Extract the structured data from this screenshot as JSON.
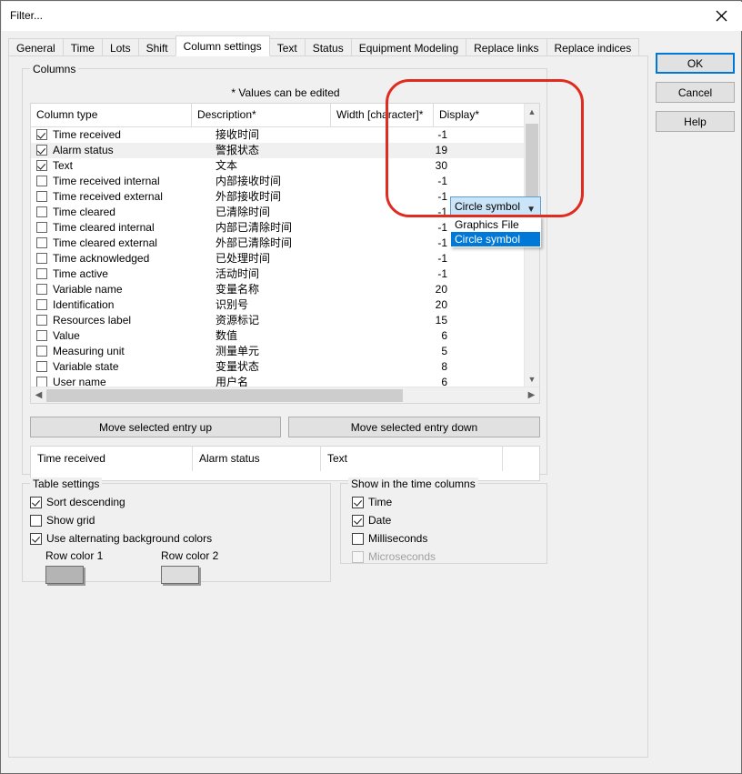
{
  "window": {
    "title": "Filter...",
    "close_icon": "close-icon"
  },
  "tabs": [
    {
      "label": "General",
      "selected": false
    },
    {
      "label": "Time",
      "selected": false
    },
    {
      "label": "Lots",
      "selected": false
    },
    {
      "label": "Shift",
      "selected": false
    },
    {
      "label": "Column settings",
      "selected": true
    },
    {
      "label": "Text",
      "selected": false
    },
    {
      "label": "Status",
      "selected": false
    },
    {
      "label": "Equipment Modeling",
      "selected": false
    },
    {
      "label": "Replace links",
      "selected": false
    },
    {
      "label": "Replace indices",
      "selected": false
    }
  ],
  "columns_group": {
    "title": "Columns",
    "note": "* Values can be edited",
    "headers": {
      "column_type": "Column type",
      "description": "Description*",
      "width": "Width [character]*",
      "display": "Display*"
    },
    "rows": [
      {
        "checked": true,
        "selected": false,
        "type": "Time received",
        "description": "接收时间",
        "width": "-1"
      },
      {
        "checked": true,
        "selected": true,
        "type": "Alarm status",
        "description": "警报状态",
        "width": "19"
      },
      {
        "checked": true,
        "selected": false,
        "type": "Text",
        "description": "文本",
        "width": "30"
      },
      {
        "checked": false,
        "selected": false,
        "type": "Time received internal",
        "description": "内部接收时间",
        "width": "-1"
      },
      {
        "checked": false,
        "selected": false,
        "type": "Time received external",
        "description": "外部接收时间",
        "width": "-1"
      },
      {
        "checked": false,
        "selected": false,
        "type": "Time cleared",
        "description": "已清除时间",
        "width": "-1"
      },
      {
        "checked": false,
        "selected": false,
        "type": "Time cleared internal",
        "description": "内部已清除时间",
        "width": "-1"
      },
      {
        "checked": false,
        "selected": false,
        "type": "Time cleared external",
        "description": "外部已清除时间",
        "width": "-1"
      },
      {
        "checked": false,
        "selected": false,
        "type": "Time acknowledged",
        "description": "已处理时间",
        "width": "-1"
      },
      {
        "checked": false,
        "selected": false,
        "type": "Time active",
        "description": "活动时间",
        "width": "-1"
      },
      {
        "checked": false,
        "selected": false,
        "type": "Variable name",
        "description": "变量名称",
        "width": "20"
      },
      {
        "checked": false,
        "selected": false,
        "type": "Identification",
        "description": "识别号",
        "width": "20"
      },
      {
        "checked": false,
        "selected": false,
        "type": "Resources label",
        "description": "资源标记",
        "width": "15"
      },
      {
        "checked": false,
        "selected": false,
        "type": "Value",
        "description": "数值",
        "width": "6"
      },
      {
        "checked": false,
        "selected": false,
        "type": "Measuring unit",
        "description": "测量单元",
        "width": "5"
      },
      {
        "checked": false,
        "selected": false,
        "type": "Variable state",
        "description": "变量状态",
        "width": "8"
      },
      {
        "checked": false,
        "selected": false,
        "type": "User name",
        "description": "用户名",
        "width": "6"
      }
    ],
    "move_up_label": "Move selected entry up",
    "move_down_label": "Move selected entry down",
    "preview_columns": [
      "Time received",
      "Alarm status",
      "Text"
    ]
  },
  "display_combo": {
    "value": "Circle symbol",
    "arrow_icon": "chevron-down-icon",
    "options": [
      {
        "label": "Graphics File",
        "highlighted": false
      },
      {
        "label": "Circle symbol",
        "highlighted": true
      }
    ]
  },
  "table_settings": {
    "title": "Table settings",
    "checkboxes": [
      {
        "label": "Sort descending",
        "checked": true,
        "disabled": false
      },
      {
        "label": "Show grid",
        "checked": false,
        "disabled": false
      },
      {
        "label": "Use alternating background colors",
        "checked": true,
        "disabled": false
      }
    ],
    "row_color_1_label": "Row color 1",
    "row_color_2_label": "Row color 2",
    "row_color_1": "#b4b4b4",
    "row_color_2": "#dddddd"
  },
  "time_columns": {
    "title": "Show in the time columns",
    "checkboxes": [
      {
        "label": "Time",
        "checked": true,
        "disabled": false
      },
      {
        "label": "Date",
        "checked": true,
        "disabled": false
      },
      {
        "label": "Milliseconds",
        "checked": false,
        "disabled": false
      },
      {
        "label": "Microseconds",
        "checked": false,
        "disabled": true
      }
    ]
  },
  "dialog_buttons": {
    "ok": "OK",
    "cancel": "Cancel",
    "help": "Help"
  },
  "colors": {
    "accent": "#0078d7",
    "annotation": "#e02b20",
    "combo_field_bg": "#cce4f7"
  }
}
